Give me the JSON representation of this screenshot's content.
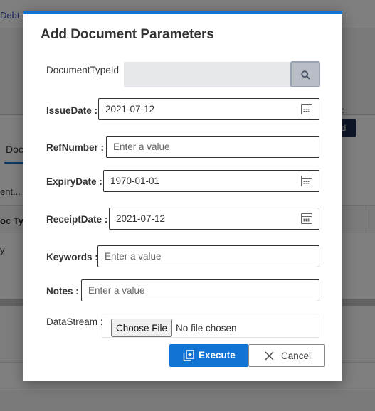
{
  "background": {
    "link_text": "Debt",
    "colon_text": ":",
    "t_text": "t:",
    "button_text": "ld",
    "tab_text": "Doc",
    "doc_text": "ent...",
    "header_text": "oc Ty",
    "row_text": "y"
  },
  "modal": {
    "title": "Add Document Parameters",
    "fields": {
      "document_type_id": {
        "label": "DocumentTypeId"
      },
      "issue_date": {
        "label": "IssueDate :",
        "value": "2021-07-12"
      },
      "ref_number": {
        "label": "RefNumber :",
        "placeholder": "Enter a value"
      },
      "expiry_date": {
        "label": "ExpiryDate :",
        "value": "1970-01-01"
      },
      "receipt_date": {
        "label": "ReceiptDate :",
        "value": "2021-07-12"
      },
      "keywords": {
        "label": "Keywords :",
        "placeholder": "Enter a value"
      },
      "notes": {
        "label": "Notes :",
        "placeholder": "Enter a value"
      },
      "data_stream": {
        "label": "DataStream :",
        "choose_label": "Choose File",
        "status": "No file chosen"
      }
    },
    "buttons": {
      "execute": "Execute",
      "cancel": "Cancel"
    },
    "accent_color": "#1173d4"
  }
}
